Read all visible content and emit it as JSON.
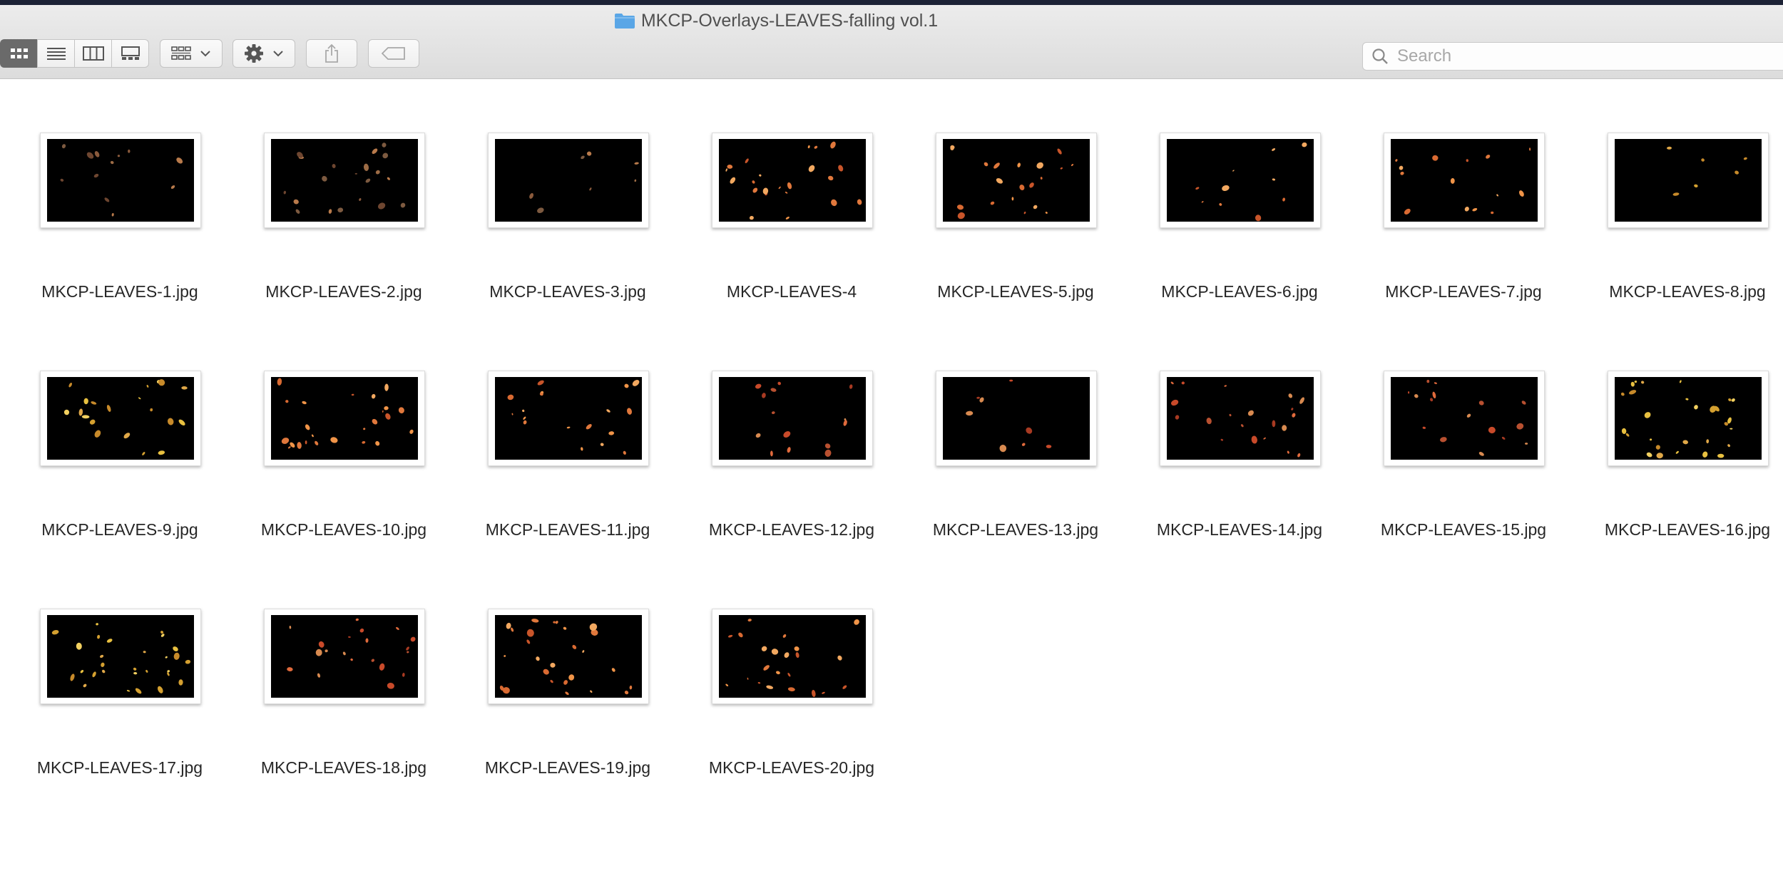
{
  "window": {
    "title": "MKCP-Overlays-LEAVES-falling vol.1"
  },
  "toolbar": {
    "view_modes": [
      {
        "icon": "icon-view-grid-icon",
        "active": true
      },
      {
        "icon": "list-view-icon",
        "active": false
      },
      {
        "icon": "column-view-icon",
        "active": false
      },
      {
        "icon": "gallery-view-icon",
        "active": false
      }
    ],
    "group_icon": "group-by-icon",
    "action_icon": "gear-icon",
    "share_icon": "share-icon",
    "tag_icon": "tag-icon"
  },
  "search": {
    "placeholder": "Search",
    "value": ""
  },
  "colors": {
    "menubar": "#1c2235",
    "active_view": "#6a6a6a",
    "folder": "#5aa6e6"
  },
  "files": [
    {
      "name": "MKCP-LEAVES-1.jpg",
      "palette": "brown",
      "density": 12
    },
    {
      "name": "MKCP-LEAVES-2.jpg",
      "palette": "brown",
      "density": 20
    },
    {
      "name": "MKCP-LEAVES-3.jpg",
      "palette": "brown",
      "density": 7
    },
    {
      "name": "MKCP-LEAVES-4",
      "palette": "orange",
      "density": 22
    },
    {
      "name": "MKCP-LEAVES-5.jpg",
      "palette": "orange",
      "density": 20
    },
    {
      "name": "MKCP-LEAVES-6.jpg",
      "palette": "orange",
      "density": 10
    },
    {
      "name": "MKCP-LEAVES-7.jpg",
      "palette": "orange",
      "density": 14
    },
    {
      "name": "MKCP-LEAVES-8.jpg",
      "palette": "yellow",
      "density": 6
    },
    {
      "name": "MKCP-LEAVES-9.jpg",
      "palette": "yellow",
      "density": 20
    },
    {
      "name": "MKCP-LEAVES-10.jpg",
      "palette": "orange",
      "density": 24
    },
    {
      "name": "MKCP-LEAVES-11.jpg",
      "palette": "orange",
      "density": 18
    },
    {
      "name": "MKCP-LEAVES-12.jpg",
      "palette": "red",
      "density": 14
    },
    {
      "name": "MKCP-LEAVES-13.jpg",
      "palette": "red",
      "density": 8
    },
    {
      "name": "MKCP-LEAVES-14.jpg",
      "palette": "red",
      "density": 20
    },
    {
      "name": "MKCP-LEAVES-15.jpg",
      "palette": "red",
      "density": 16
    },
    {
      "name": "MKCP-LEAVES-16.jpg",
      "palette": "yellow",
      "density": 28
    },
    {
      "name": "MKCP-LEAVES-17.jpg",
      "palette": "yellow",
      "density": 28
    },
    {
      "name": "MKCP-LEAVES-18.jpg",
      "palette": "red",
      "density": 20
    },
    {
      "name": "MKCP-LEAVES-19.jpg",
      "palette": "orange",
      "density": 26
    },
    {
      "name": "MKCP-LEAVES-20.jpg",
      "palette": "orange",
      "density": 22
    }
  ]
}
